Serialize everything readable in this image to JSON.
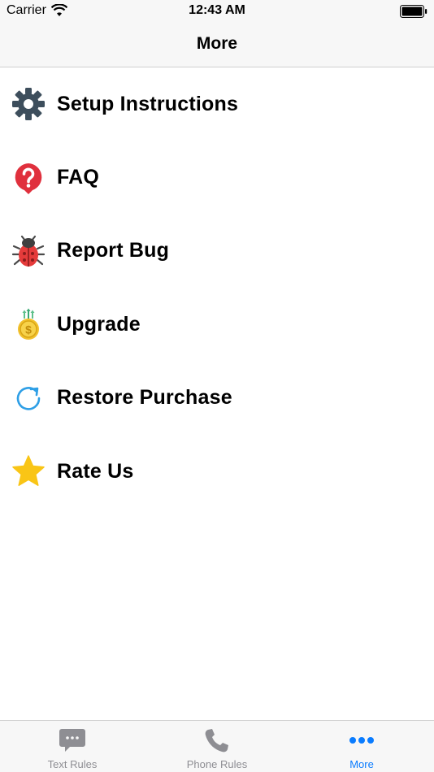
{
  "status_bar": {
    "carrier": "Carrier",
    "time": "12:43 AM"
  },
  "nav": {
    "title": "More"
  },
  "menu": {
    "items": [
      {
        "label": "Setup Instructions",
        "icon": "gear-icon"
      },
      {
        "label": "FAQ",
        "icon": "question-icon"
      },
      {
        "label": "Report Bug",
        "icon": "bug-icon"
      },
      {
        "label": "Upgrade",
        "icon": "upgrade-coin-icon"
      },
      {
        "label": "Restore Purchase",
        "icon": "restore-icon"
      },
      {
        "label": "Rate Us",
        "icon": "star-icon"
      }
    ]
  },
  "tabs": [
    {
      "label": "Text Rules",
      "icon": "chat-bubble-icon",
      "active": false
    },
    {
      "label": "Phone Rules",
      "icon": "phone-icon",
      "active": false
    },
    {
      "label": "More",
      "icon": "more-dots-icon",
      "active": true
    }
  ],
  "colors": {
    "accent": "#0a7cff",
    "inactive_tab": "#8e8e93",
    "gear": "#3d4e5c",
    "faq_red": "#e0303d",
    "bug_red": "#e53b3b",
    "coin_gold": "#f2c12e",
    "restore_blue": "#2e9fe6",
    "star_yellow": "#f9c516"
  }
}
